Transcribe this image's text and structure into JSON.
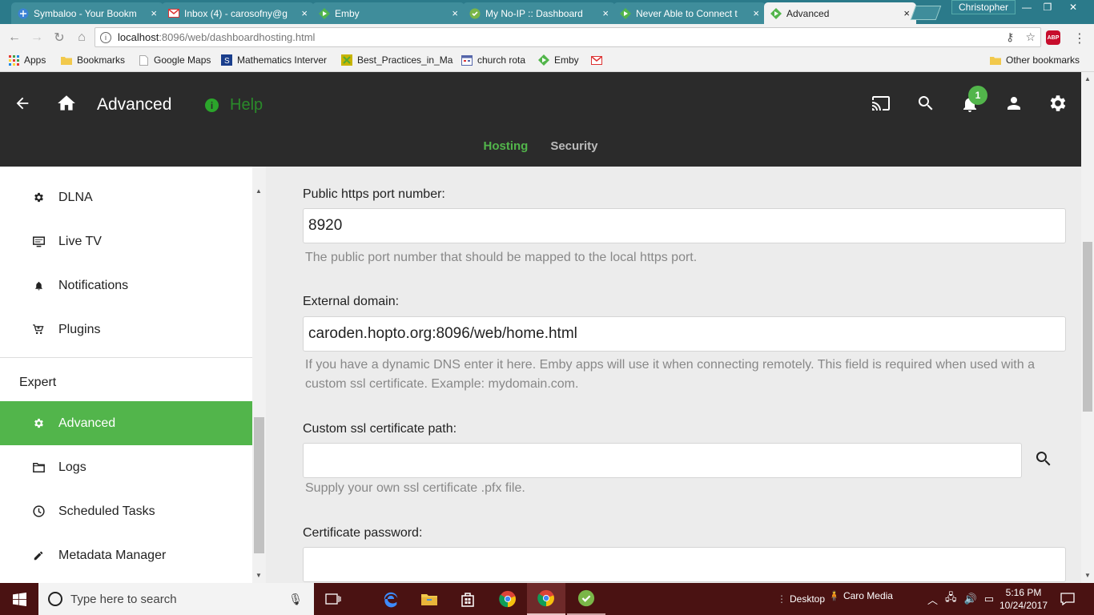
{
  "browser": {
    "tabs": [
      {
        "title": "Symbaloo - Your Bookm",
        "icon": "symbaloo-icon"
      },
      {
        "title": "Inbox (4) - carosofny@g",
        "icon": "gmail-icon"
      },
      {
        "title": "Emby",
        "icon": "emby-icon"
      },
      {
        "title": "My No-IP :: Dashboard",
        "icon": "noip-icon"
      },
      {
        "title": "Never Able to Connect t",
        "icon": "emby-icon"
      },
      {
        "title": "Advanced",
        "icon": "emby-icon"
      }
    ],
    "close_glyph": "×",
    "profile_name": "Christopher",
    "window_controls": {
      "minimize": "—",
      "restore": "❐",
      "close": "✕"
    },
    "url_host": "localhost",
    "url_path": ":8096/web/dashboardhosting.html",
    "abp_label": "ABP",
    "bookmarks": [
      {
        "label": "Apps",
        "icon": "apps-grid-icon"
      },
      {
        "label": "Bookmarks",
        "icon": "folder-icon"
      },
      {
        "label": "Google Maps",
        "icon": "page-icon"
      },
      {
        "label": "Mathematics Interver",
        "icon": "site-icon"
      },
      {
        "label": "Best_Practices_in_Ma",
        "icon": "site-icon"
      },
      {
        "label": "church rota",
        "icon": "calendar-icon"
      },
      {
        "label": "Emby",
        "icon": "emby-icon"
      },
      {
        "label": "",
        "icon": "gmail-icon"
      }
    ],
    "other_bookmarks": "Other bookmarks"
  },
  "header": {
    "title": "Advanced",
    "help_label": "Help",
    "notification_count": "1",
    "tabs": [
      {
        "label": "Hosting",
        "active": true
      },
      {
        "label": "Security",
        "active": false
      }
    ]
  },
  "sidebar": {
    "items_top": [
      {
        "label": "DLNA",
        "icon": "gear-icon"
      },
      {
        "label": "Live TV",
        "icon": "tv-icon"
      },
      {
        "label": "Notifications",
        "icon": "bell-icon"
      },
      {
        "label": "Plugins",
        "icon": "cart-icon"
      }
    ],
    "section_title": "Expert",
    "items_expert": [
      {
        "label": "Advanced",
        "icon": "gear-icon",
        "active": true
      },
      {
        "label": "Logs",
        "icon": "folder-icon"
      },
      {
        "label": "Scheduled Tasks",
        "icon": "clock-icon"
      },
      {
        "label": "Metadata Manager",
        "icon": "pencil-icon"
      }
    ]
  },
  "form": {
    "https_port": {
      "label": "Public https port number:",
      "value": "8920",
      "description": "The public port number that should be mapped to the local https port."
    },
    "external_domain": {
      "label": "External domain:",
      "value": "caroden.hopto.org:8096/web/home.html",
      "description": "If you have a dynamic DNS enter it here. Emby apps will use it when connecting remotely. This field is required when used with a custom ssl certificate. Example: mydomain.com."
    },
    "ssl_path": {
      "label": "Custom ssl certificate path:",
      "value": "",
      "description": "Supply your own ssl certificate .pfx file."
    },
    "cert_password": {
      "label": "Certificate password:",
      "value": ""
    }
  },
  "taskbar": {
    "search_placeholder": "Type here to search",
    "desktop_label": "Desktop",
    "caro_media_label": "Caro Media",
    "time": "5:16 PM",
    "date": "10/24/2017"
  },
  "colors": {
    "accent_green": "#52b54b",
    "header_dark": "#2b2b2b",
    "chrome_teal": "#2b7a8a",
    "taskbar": "#4a1212"
  }
}
